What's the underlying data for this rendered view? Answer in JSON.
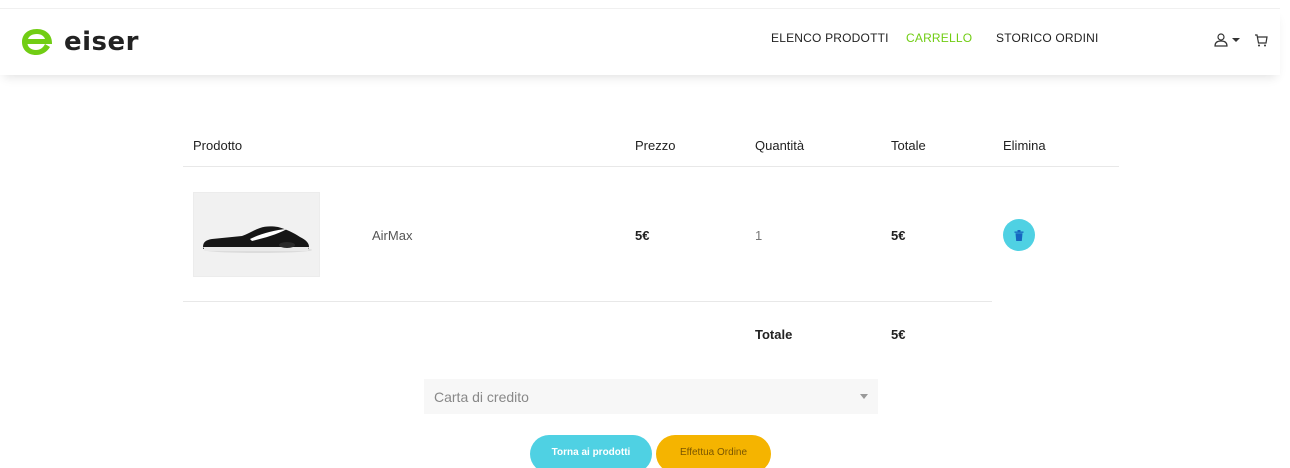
{
  "brand": {
    "name": "eiser",
    "logo_color": "#71cd14"
  },
  "nav": {
    "items": [
      {
        "label": "ELENCO PRODOTTI",
        "active": false
      },
      {
        "label": "CARRELLO",
        "active": true
      },
      {
        "label": "STORICO ORDINI",
        "active": false
      }
    ],
    "active_color": "#71cd14"
  },
  "header_icons": [
    "user-icon",
    "caret-down-icon",
    "cart-icon"
  ],
  "cart": {
    "columns": [
      "Prodotto",
      "Prezzo",
      "Quantità",
      "Totale",
      "Elimina"
    ],
    "rows": [
      {
        "name": "AirMax",
        "price": "5€",
        "quantity": "1",
        "total": "5€",
        "image_icon": "sneaker-image"
      }
    ],
    "total_label": "Totale",
    "total_value": "5€"
  },
  "payment": {
    "selected": "Carta di credito"
  },
  "actions": {
    "back_label": "Torna ai prodotti",
    "order_label": "Effettua Ordine",
    "back_color": "#4fd1e3",
    "order_color": "#f5b400"
  }
}
